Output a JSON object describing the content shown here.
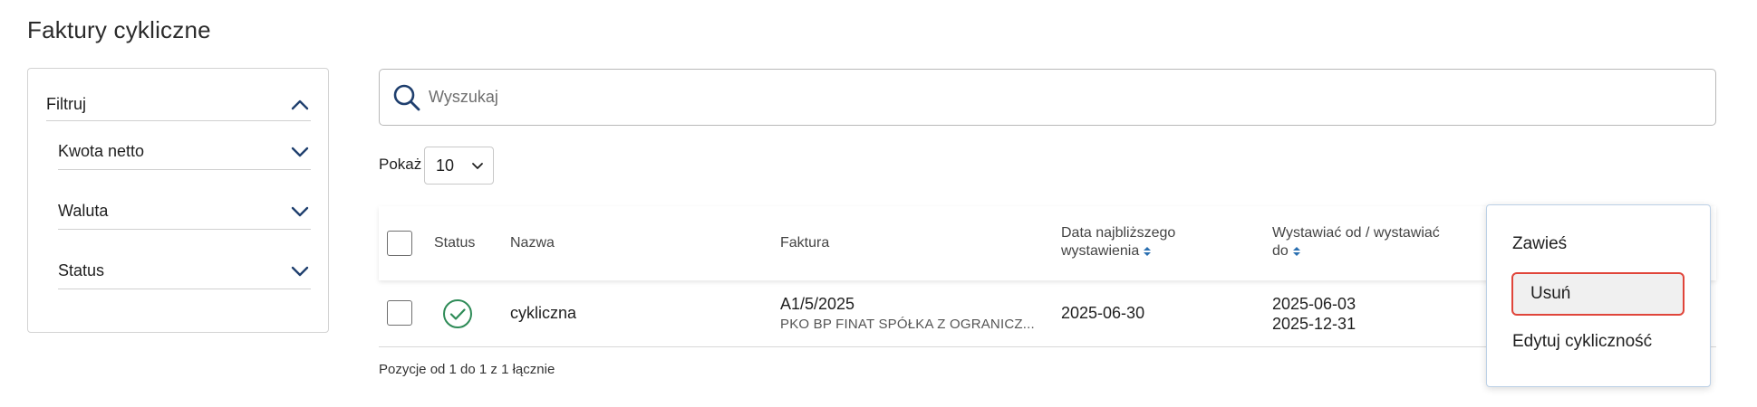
{
  "page": {
    "title": "Faktury cykliczne"
  },
  "filter": {
    "header_label": "Filtruj",
    "items": [
      {
        "label": "Kwota netto"
      },
      {
        "label": "Waluta"
      },
      {
        "label": "Status"
      }
    ]
  },
  "search": {
    "placeholder": "Wyszukaj",
    "value": ""
  },
  "pagination": {
    "show_label": "Pokaż",
    "page_size": "10"
  },
  "table": {
    "columns": {
      "status": "Status",
      "name": "Nazwa",
      "invoice": "Faktura",
      "next_date_line1": "Data najbliższego",
      "next_date_line2": "wystawienia",
      "range_line1": "Wystawiać od / wystawiać",
      "range_line2": "do"
    },
    "rows": [
      {
        "status": "active",
        "name": "cykliczna",
        "invoice_number": "A1/5/2025",
        "invoice_company": "PKO BP FINAT SPÓŁKA Z OGRANICZ...",
        "next_date": "2025-06-30",
        "from_date": "2025-06-03",
        "to_date": "2025-12-31"
      }
    ],
    "footer": "Pozycje od 1 do 1 z 1 łącznie"
  },
  "context_menu": {
    "items": [
      {
        "label": "Zawieś"
      },
      {
        "label": "Usuń"
      },
      {
        "label": "Edytuj cykliczność"
      }
    ],
    "highlighted_item": "Usuń"
  },
  "colors": {
    "accent_navy": "#1f3f6e",
    "status_green": "#2e8b57",
    "highlight_red": "#e0453a"
  }
}
